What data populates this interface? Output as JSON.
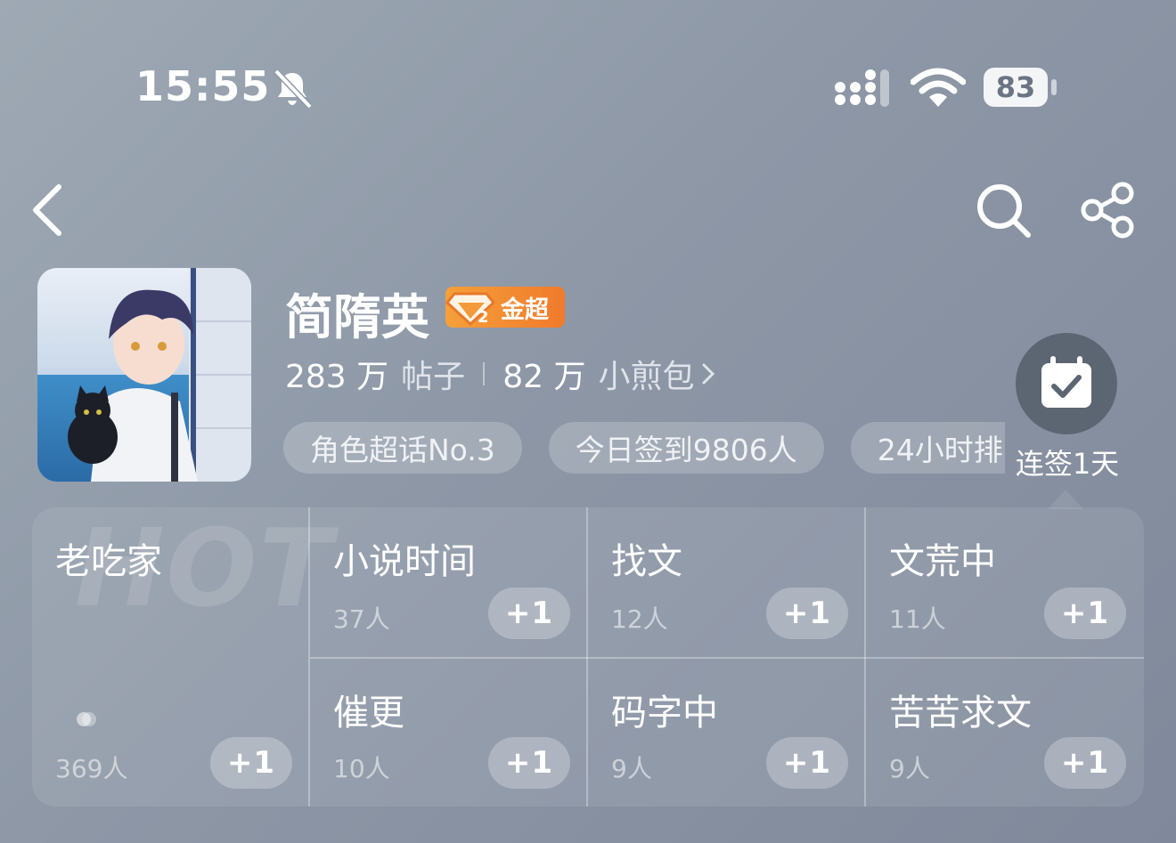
{
  "status_bar": {
    "time": "15:55",
    "battery": "83"
  },
  "topic": {
    "title": "简隋英",
    "badge_label": "金超",
    "posts_count": "283 万",
    "posts_label": "帖子",
    "points_count": "82 万",
    "points_label": "小煎包"
  },
  "tags": [
    "角色超话No.3",
    "今日签到9806人",
    "24小时排"
  ],
  "checkin": {
    "label": "连签1天"
  },
  "grid": {
    "watermark": "HOT",
    "featured": {
      "name": "老吃家",
      "count": "369人",
      "plus": "+1"
    },
    "cells": [
      {
        "name": "小说时间",
        "count": "37人",
        "plus": "+1"
      },
      {
        "name": "找文",
        "count": "12人",
        "plus": "+1"
      },
      {
        "name": "文荒中",
        "count": "11人",
        "plus": "+1"
      },
      {
        "name": "催更",
        "count": "10人",
        "plus": "+1"
      },
      {
        "name": "码字中",
        "count": "9人",
        "plus": "+1"
      },
      {
        "name": "苦苦求文",
        "count": "9人",
        "plus": "+1"
      }
    ]
  }
}
